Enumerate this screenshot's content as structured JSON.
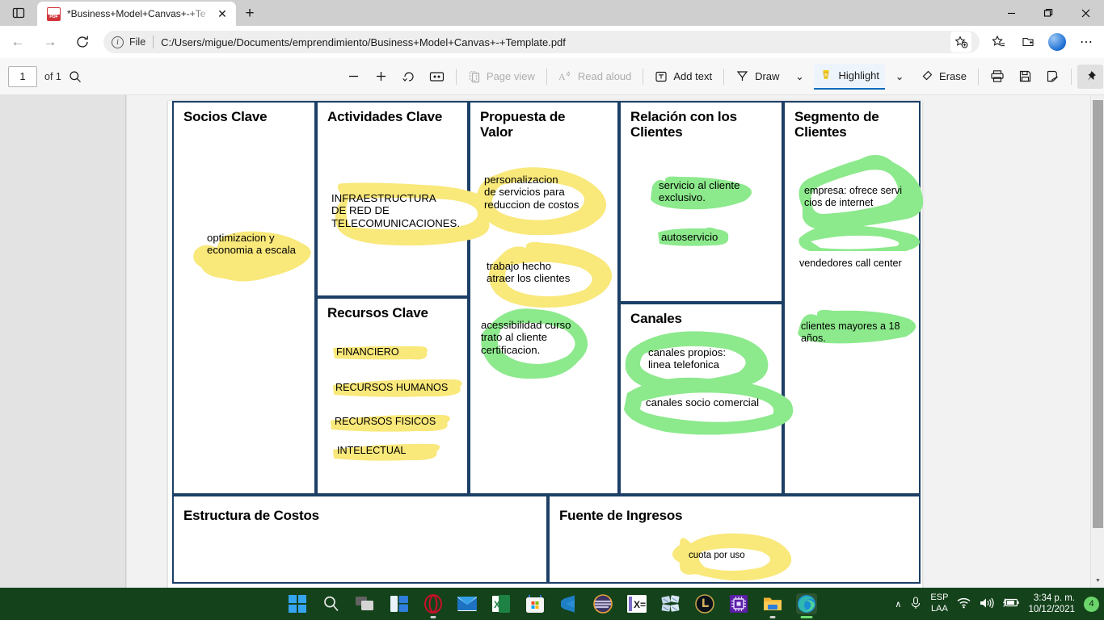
{
  "window": {
    "tab_title": "*Business+Model+Canvas+-+Te",
    "tab_icon": "pdf-file-icon",
    "new_tab_label": "+",
    "close_tab_label": "✕",
    "minimize_label": "—",
    "maximize_label": "❐",
    "close_label": "✕",
    "tab_search_label": "◫"
  },
  "navbar": {
    "back_label": "←",
    "forward_label": "→",
    "refresh_label": "↻",
    "info_label": "i",
    "file_label": "File",
    "url": "C:/Users/migue/Documents/emprendimiento/Business+Model+Canvas+-+Template.pdf",
    "add_favorite_label": "☆",
    "favorites_label": "☆",
    "collections_label": "❐",
    "profile_label": "",
    "settings_label": "⋯"
  },
  "pdf_toolbar": {
    "page_number": "1",
    "page_total": "of 1",
    "search_label": "⌕",
    "zoom_out_label": "−",
    "zoom_in_label": "+",
    "rotate_label": "↻",
    "fit_label": "▭",
    "page_view_label": "Page view",
    "read_aloud_label": "Read aloud",
    "add_text_label": "Add text",
    "draw_label": "Draw",
    "highlight_label": "Highlight",
    "erase_label": "Erase",
    "print_label": "⎙",
    "save_label": "Ὃe",
    "save_as_label": "὚b",
    "pin_label": "Ὄc",
    "caret_label": "⌄"
  },
  "canvas": {
    "blocks": [
      {
        "id": "socios-clave",
        "title": "Socios Clave"
      },
      {
        "id": "actividades-clave",
        "title": "Actividades Clave"
      },
      {
        "id": "recursos-clave",
        "title": "Recursos Clave"
      },
      {
        "id": "propuesta-de-valor",
        "title": "Propuesta de Valor"
      },
      {
        "id": "relacion-con-los-clientes",
        "title": "Relación con los Clientes"
      },
      {
        "id": "canales",
        "title": "Canales"
      },
      {
        "id": "segmento-de-clientes",
        "title": "Segmento de Clientes"
      },
      {
        "id": "estructura-de-costos",
        "title": "Estructura de Costos"
      },
      {
        "id": "fuente-de-ingresos",
        "title": "Fuente de Ingresos"
      }
    ],
    "notes": {
      "socios_1": "optimizacion y\neconomia a escala",
      "actividades_1": "INFRAESTRUCTURA\nDE RED DE\nTELECOMUNICACIONES.",
      "recursos_1": "FINANCIERO",
      "recursos_2": "RECURSOS HUMANOS",
      "recursos_3": "RECURSOS FISICOS",
      "recursos_4": "INTELECTUAL",
      "propuesta_1": "personalizacion\nde servicios para\nreduccion de costos",
      "propuesta_2": "trabajo hecho\natraer los clientes",
      "propuesta_3": "acessibilidad curso\ntrato al cliente\ncertificacion.",
      "relacion_1": "servicio al cliente\nexclusivo.",
      "relacion_2": "autoservicio",
      "canales_1": "canales propios:\nlinea telefonica",
      "canales_2": "canales socio comercial",
      "segmento_1": "empresa: ofrece servi\ncios de internet",
      "segmento_2": "vendedores call center",
      "segmento_3": "clientes mayores a 18\naños.",
      "ingresos_1": "cuota por uso"
    },
    "colors": {
      "border": "#1c3f66",
      "highlight_yellow": "#f9e87a",
      "highlight_green": "#8ce98c",
      "text": "#000000"
    }
  },
  "taskbar": {
    "items": [
      {
        "name": "start",
        "label": "Start"
      },
      {
        "name": "search",
        "label": "Search"
      },
      {
        "name": "task-view",
        "label": "Task View"
      },
      {
        "name": "widgets",
        "label": "Widgets"
      },
      {
        "name": "opera",
        "label": "Opera"
      },
      {
        "name": "mail",
        "label": "Mail"
      },
      {
        "name": "excel",
        "label": "Excel"
      },
      {
        "name": "microsoft-store",
        "label": "Microsoft Store"
      },
      {
        "name": "vs-code",
        "label": "Visual Studio Code"
      },
      {
        "name": "eclipse",
        "label": "Eclipse"
      },
      {
        "name": "xampp",
        "label": "XAMPP"
      },
      {
        "name": "app-4",
        "label": "App"
      },
      {
        "name": "league-of-legends",
        "label": "League of Legends"
      },
      {
        "name": "cpu-z",
        "label": "CPU Monitor"
      },
      {
        "name": "file-explorer",
        "label": "File Explorer"
      },
      {
        "name": "microsoft-edge",
        "label": "Microsoft Edge"
      }
    ],
    "tray": {
      "overflow_label": "∧",
      "mic_label": "mic",
      "language_line1": "ESP",
      "language_line2": "LAA",
      "wifi_label": "wifi",
      "volume_label": "volume",
      "battery_label": "battery",
      "time": "3:34 p. m.",
      "date": "10/12/2021",
      "notification_count": "4"
    }
  }
}
